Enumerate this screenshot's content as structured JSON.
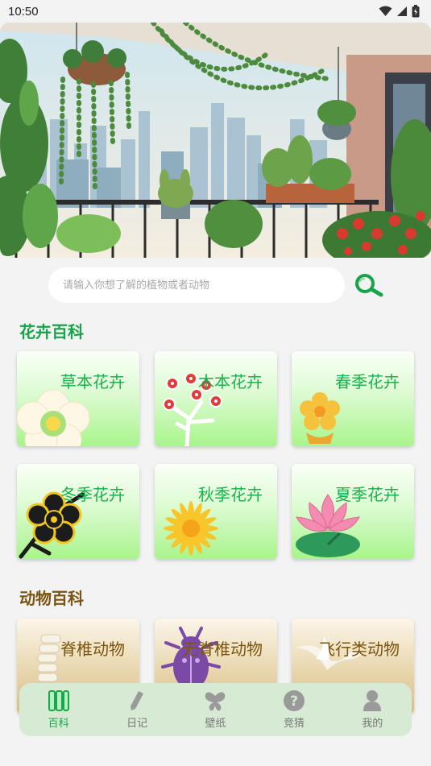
{
  "status_bar": {
    "time": "10:50",
    "icons": [
      "wifi-icon",
      "signal-icon",
      "battery-icon"
    ]
  },
  "hero": {
    "image": "balcony-garden-illustration"
  },
  "search": {
    "placeholder": "请输入你想了解的植物或者动物",
    "value": "",
    "icon": "search-icon"
  },
  "flower_section": {
    "title": "花卉百科",
    "cards": [
      {
        "label": "草本花卉",
        "icon": "white-flower-icon"
      },
      {
        "label": "木本花卉",
        "icon": "red-blossom-branch-icon"
      },
      {
        "label": "春季花卉",
        "icon": "yellow-flower-icon"
      },
      {
        "label": "冬季花卉",
        "icon": "plum-blossom-icon"
      },
      {
        "label": "秋季花卉",
        "icon": "chrysanthemum-icon"
      },
      {
        "label": "夏季花卉",
        "icon": "lotus-icon"
      }
    ]
  },
  "animal_section": {
    "title": "动物百科",
    "cards": [
      {
        "label": "脊椎动物",
        "icon": "spine-icon"
      },
      {
        "label": "无脊椎动物",
        "icon": "beetle-icon"
      },
      {
        "label": "飞行类动物",
        "icon": "bird-icon"
      }
    ]
  },
  "bottom_nav": {
    "items": [
      {
        "label": "百科",
        "icon": "books-icon",
        "active": true
      },
      {
        "label": "日记",
        "icon": "pencil-icon",
        "active": false
      },
      {
        "label": "壁纸",
        "icon": "butterfly-icon",
        "active": false
      },
      {
        "label": "竞猜",
        "icon": "question-icon",
        "active": false
      },
      {
        "label": "我的",
        "icon": "user-icon",
        "active": false
      }
    ]
  },
  "colors": {
    "accent_green": "#17a84a",
    "animal_brown": "#7a5410",
    "nav_background": "#d7ead4",
    "page_background": "#f3f3f3"
  }
}
